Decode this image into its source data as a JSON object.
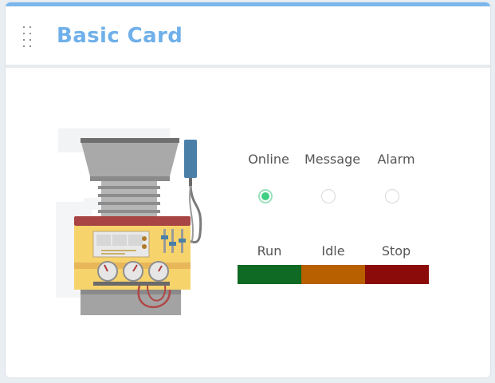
{
  "card": {
    "title": "Basic Card",
    "drag_icon": "drag-handle-icon",
    "accent_color": "#7ab6ec"
  },
  "machine": {
    "icon": "industrial-machine-illustration"
  },
  "status": {
    "items": [
      {
        "label": "Online",
        "active": true
      },
      {
        "label": "Message",
        "active": false
      },
      {
        "label": "Alarm",
        "active": false
      }
    ],
    "active_color": "#3fcf83"
  },
  "states": {
    "items": [
      {
        "label": "Run",
        "color": "#0f6a23"
      },
      {
        "label": "Idle",
        "color": "#b85f00"
      },
      {
        "label": "Stop",
        "color": "#8b0a0a"
      }
    ]
  }
}
